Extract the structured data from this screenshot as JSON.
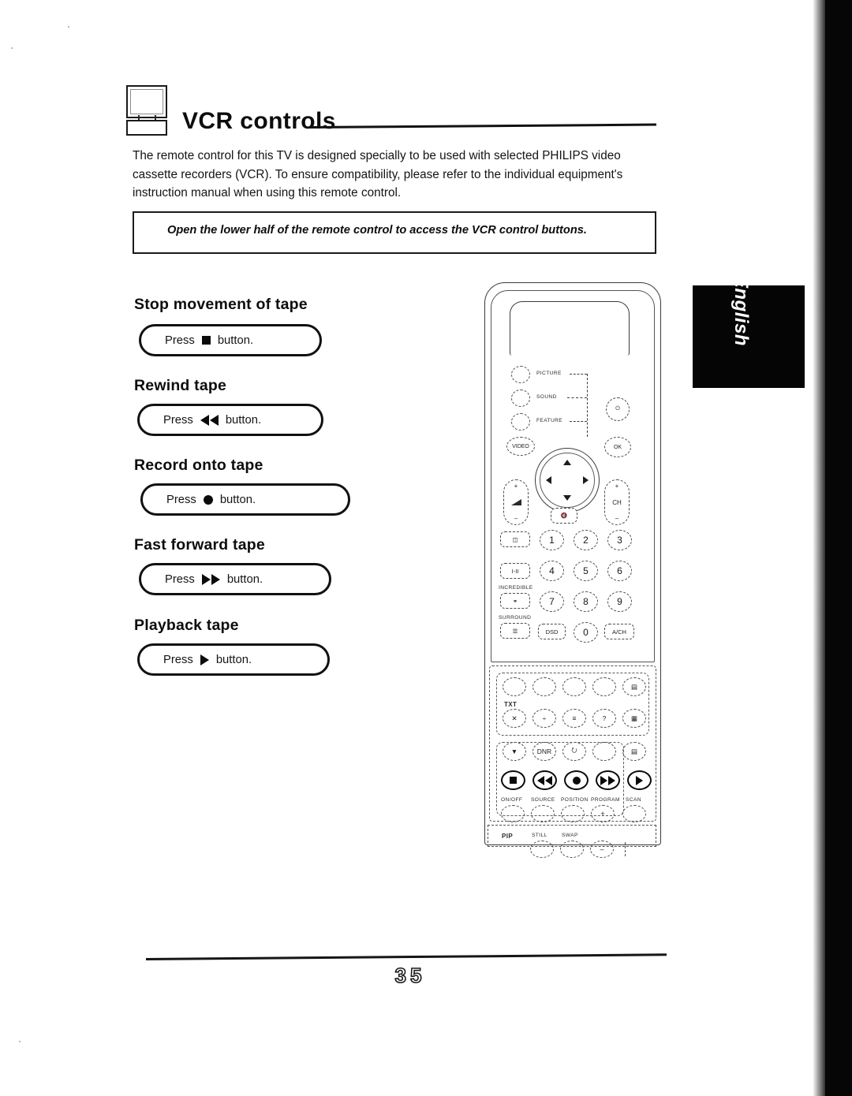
{
  "document": {
    "page_number": "35",
    "language_tab": "English"
  },
  "header": {
    "icon": "tv-monitor-icon",
    "title": "VCR controls"
  },
  "intro": {
    "paragraph": "The remote control for this TV is designed specially to be used with selected PHILIPS video cassette recorders (VCR).  To ensure compatibility, please refer to the individual equipment's instruction manual when using this remote control."
  },
  "note": {
    "text": "Open the lower half of the remote control to access the VCR control buttons."
  },
  "instructions": [
    {
      "heading": "Stop movement of tape",
      "press_label": "Press",
      "glyph": "stop-square-glyph",
      "button_label": "button."
    },
    {
      "heading": "Rewind tape",
      "press_label": "Press",
      "glyph": "rewind-double-triangle-glyph",
      "button_label": "button."
    },
    {
      "heading": "Record onto tape",
      "press_label": "Press",
      "glyph": "record-circle-glyph",
      "button_label": "button."
    },
    {
      "heading": "Fast forward tape",
      "press_label": "Press",
      "glyph": "fast-forward-double-triangle-glyph",
      "button_label": "button."
    },
    {
      "heading": "Playback tape",
      "press_label": "Press",
      "glyph": "play-triangle-glyph",
      "button_label": "button."
    }
  ],
  "remote": {
    "menu_labels": [
      "PICTURE",
      "SOUND",
      "FEATURE"
    ],
    "video_button": "VIDEO",
    "ok_button": "OK",
    "power_button": "power-icon",
    "volume_rocker": {
      "plus": "+",
      "minus": "–"
    },
    "channel_rocker": {
      "plus": "+",
      "label": "CH",
      "minus": "–"
    },
    "mute_button": "mute-icon",
    "keypad": [
      "1",
      "2",
      "3",
      "4",
      "5",
      "6",
      "7",
      "8",
      "9",
      "0"
    ],
    "keypad_extra": [
      "DSD",
      "A/CH"
    ],
    "side_keys": [
      "pip-swap-icon",
      "I-II",
      "incredible-icon",
      "surround-icon",
      "list-icon"
    ],
    "side_key_labels": [
      "INCREDIBLE",
      "SURROUND"
    ],
    "teletext_label": "TXT",
    "teletext_keys": [
      "✕",
      "÷",
      "≡",
      "?",
      "▦"
    ],
    "feature_keys": [
      "▼",
      "DNR",
      "⭮",
      "",
      "▤"
    ],
    "vcr_transport": [
      {
        "name": "stop",
        "glyph": "stop-square-glyph"
      },
      {
        "name": "rewind",
        "glyph": "rewind-double-triangle-glyph"
      },
      {
        "name": "record",
        "glyph": "record-circle-glyph"
      },
      {
        "name": "fast-forward",
        "glyph": "fast-forward-double-triangle-glyph"
      },
      {
        "name": "play",
        "glyph": "play-triangle-glyph"
      }
    ],
    "pip_top_labels": [
      "ON/OFF",
      "SOURCE",
      "POSITION",
      "PROGRAM",
      "SCAN"
    ],
    "pip_bottom_labels": [
      "PIP",
      "STILL",
      "SWAP"
    ],
    "program_plus": "+",
    "program_minus": "–"
  }
}
